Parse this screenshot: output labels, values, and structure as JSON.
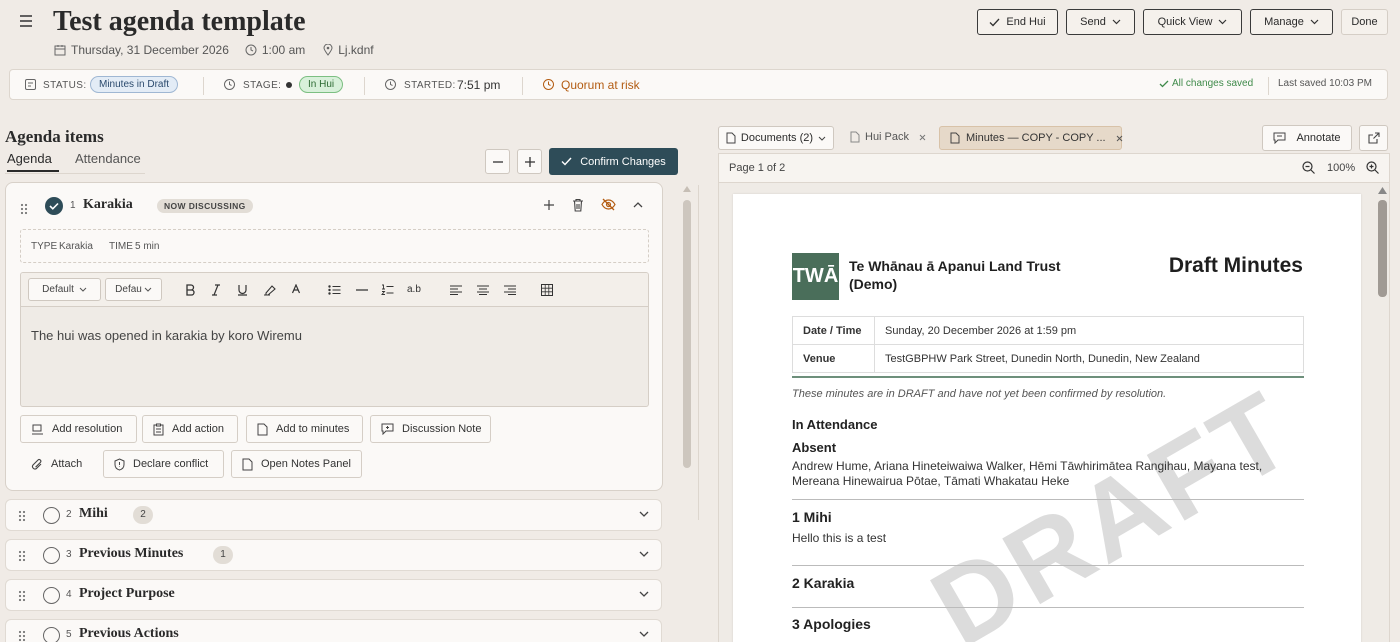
{
  "header": {
    "title": "Test agenda template",
    "date": "Thursday, 31 December 2026",
    "time": "1:00 am",
    "location": "Lj.kdnf",
    "buttons": {
      "end": "End Hui",
      "send": "Send",
      "quick_view": "Quick View",
      "manage": "Manage",
      "done": "Done"
    }
  },
  "status_bar": {
    "status_label": "STATUS:",
    "status_value": "Minutes in Draft",
    "stage_label": "STAGE:",
    "stage_value": "In Hui",
    "started_label": "STARTED:",
    "started_value": "7:51 pm",
    "quorum": "Quorum at risk",
    "saved": "All changes saved",
    "last_saved": "Last saved 10:03 PM"
  },
  "agenda": {
    "heading": "Agenda items",
    "tabs": [
      "Agenda",
      "Attendance"
    ],
    "confirm_label": "Confirm Changes",
    "active_item": {
      "number": "1",
      "title": "Karakia",
      "badge": "NOW DISCUSSING",
      "type_label": "TYPE",
      "type_value": "Karakia",
      "time_label": "TIME",
      "time_value": "5 min",
      "editor": {
        "style_select": "Default",
        "font_select": "Defau",
        "body": "The hui was opened in karakia by koro Wiremu"
      },
      "actions": [
        "Add resolution",
        "Add action",
        "Add to minutes",
        "Discussion Note",
        "Attach",
        "Declare conflict",
        "Open Notes Panel"
      ]
    },
    "items": [
      {
        "number": "2",
        "title": "Mihi",
        "count": "2"
      },
      {
        "number": "3",
        "title": "Previous Minutes",
        "count": "1"
      },
      {
        "number": "4",
        "title": "Project Purpose"
      },
      {
        "number": "5",
        "title": "Previous Actions"
      }
    ]
  },
  "viewer": {
    "tabs": {
      "documents": "Documents (2)",
      "hui_pack": "Hui Pack",
      "minutes": "Minutes — COPY - COPY ..."
    },
    "annotate": "Annotate",
    "page_indicator": "Page 1 of 2",
    "zoom": "100%",
    "document": {
      "logo": "TWĀ",
      "org_name": "Te Whānau ā Apanui Land Trust (Demo)",
      "doc_title": "Draft Minutes",
      "date_label": "Date / Time",
      "date_value": "Sunday, 20 December 2026 at 1:59 pm",
      "venue_label": "Venue",
      "venue_value": "TestGBPHW Park Street, Dunedin North, Dunedin, New Zealand",
      "notice": "These minutes are in DRAFT and have not yet been confirmed by resolution.",
      "in_attendance": "In Attendance",
      "absent": "Absent",
      "absent_names": "Andrew Hume, Ariana Hineteiwaiwa Walker, Hēmi Tāwhirimātea Rangihau, Mayana test, Mereana Hinewairua Pōtae, Tāmati Whakatau Heke",
      "sections": [
        {
          "heading": "1 Mihi",
          "body": "Hello this is a test"
        },
        {
          "heading": "2 Karakia",
          "body": ""
        },
        {
          "heading": "3 Apologies",
          "body": ""
        }
      ],
      "watermark": "DRAFT"
    }
  },
  "colors": {
    "accent": "#2e4c58",
    "logo_green": "#4a6e5a",
    "quorum": "#b35c12",
    "stage_pill": "#d8f0da",
    "status_pill": "#e3ecf6"
  }
}
